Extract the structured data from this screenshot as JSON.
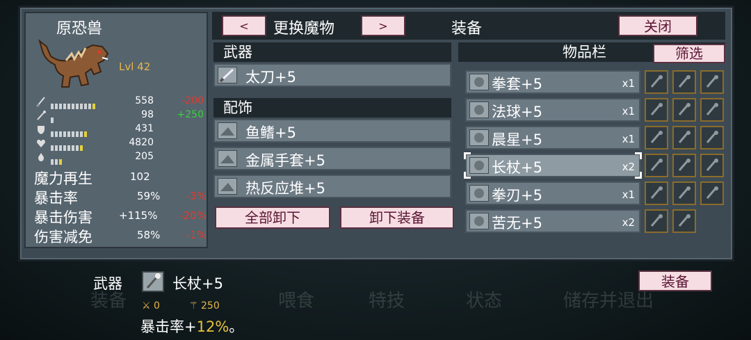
{
  "monster": {
    "name": "原恐兽",
    "level": "Lvl 42"
  },
  "stats": [
    {
      "icon": "sword-stat-icon",
      "value": "558",
      "delta": "-200",
      "delta_type": "neg",
      "fill": 0.85
    },
    {
      "icon": "staff-stat-icon",
      "value": "98",
      "delta": "+250",
      "delta_type": "pos",
      "fill": 0.05
    },
    {
      "icon": "shield-stat-icon",
      "value": "431",
      "delta": "",
      "delta_type": "",
      "fill": 0.7
    },
    {
      "icon": "heart-stat-icon",
      "value": "4820",
      "delta": "",
      "delta_type": "",
      "fill": 0.65
    },
    {
      "icon": "mana-stat-icon",
      "value": "205",
      "delta": "",
      "delta_type": "",
      "fill": 0.25
    }
  ],
  "big_stats": [
    {
      "label": "魔力再生",
      "value": "102",
      "delta": ""
    },
    {
      "label": "暴击率",
      "value": "59%",
      "delta": "-3%"
    },
    {
      "label": "暴击伤害",
      "value": "+115%",
      "delta": "-20%"
    },
    {
      "label": "伤害减免",
      "value": "58%",
      "delta": "-1%"
    }
  ],
  "header": {
    "prev": "<",
    "change_monster": "更换魔物",
    "next": ">",
    "equipment": "装备",
    "close": "关闭"
  },
  "weapon_section": {
    "title": "武器",
    "item": "太刀+5"
  },
  "accessory_section": {
    "title": "配饰",
    "items": [
      "鱼鳍+5",
      "金属手套+5",
      "热反应堆+5"
    ]
  },
  "actions": {
    "unequip_all": "全部卸下",
    "unequip": "卸下装备"
  },
  "inventory": {
    "title": "物品栏",
    "filter": "筛选",
    "items": [
      {
        "name": "拳套+5",
        "qty": "x1",
        "icon": "knuckle-icon",
        "selected": false
      },
      {
        "name": "法球+5",
        "qty": "x1",
        "icon": "orb-icon",
        "selected": false
      },
      {
        "name": "晨星+5",
        "qty": "x1",
        "icon": "morningstar-icon",
        "selected": false
      },
      {
        "name": "长杖+5",
        "qty": "x2",
        "icon": "staff-icon",
        "selected": true
      },
      {
        "name": "拳刃+5",
        "qty": "x1",
        "icon": "claw-icon",
        "selected": false
      },
      {
        "name": "苦无+5",
        "qty": "x2",
        "icon": "kunai-icon",
        "selected": false
      }
    ],
    "grid_icons": [
      "gauntlet-icon",
      "mace-icon",
      "hammer-icon",
      "fin-icon",
      "wand-icon",
      "dagger-icon",
      "torch-icon",
      "bow-icon",
      "rod-icon",
      "scepter-icon",
      "scythe-icon",
      "whip-icon",
      "sword-icon",
      "hook-icon",
      "bomb-icon",
      "leaf-blade-icon",
      "trident-icon"
    ]
  },
  "detail": {
    "slot_label": "武器",
    "item_name": "长杖+5",
    "stat_a": "0",
    "stat_b": "250",
    "effect_prefix": "暴击率+",
    "effect_value": "12%",
    "effect_suffix": "。",
    "equip": "装备"
  },
  "colors": {
    "panel": "#3d4a54",
    "button_bg": "#f6dde3",
    "button_text": "#5b1532",
    "negative": "#e23a2a",
    "positive": "#36d23a",
    "gold": "#e8b64a"
  }
}
